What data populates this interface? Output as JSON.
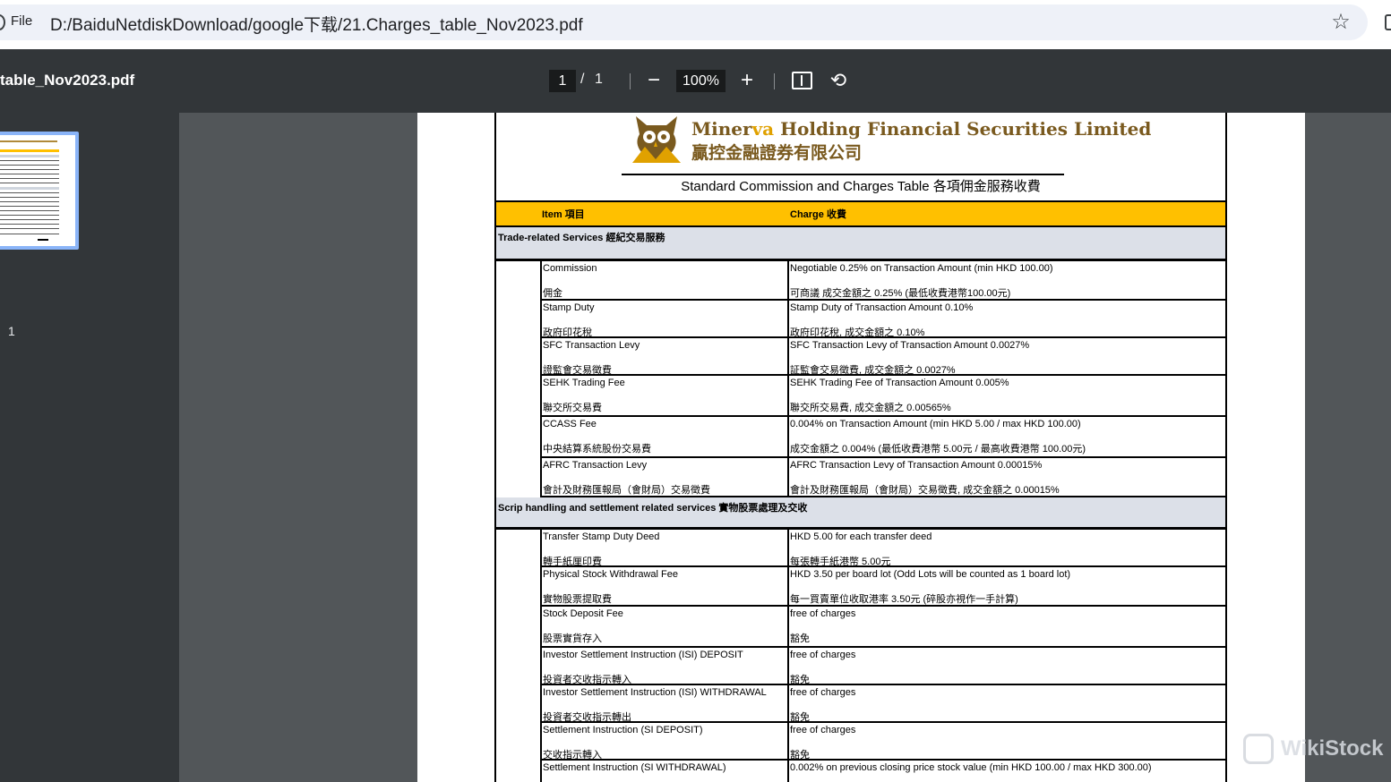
{
  "browser": {
    "chip": "File",
    "url": "D:/BaiduNetdiskDownload/google下载/21.Charges_table_Nov2023.pdf"
  },
  "toolbar": {
    "title": "table_Nov2023.pdf",
    "page_current": "1",
    "page_sep": "/",
    "page_total": "1",
    "zoom": "100%"
  },
  "sidebar": {
    "thumb_label": "1"
  },
  "document": {
    "logo_en_main": "Miner",
    "logo_en_accent": "va",
    "logo_en_rest": " Holding Financial Securities Limited",
    "logo_zh": "贏控金融證券有限公司",
    "table_title": "Standard Commission and Charges Table 各項佣金服務收費",
    "header_item": "Item 項目",
    "header_charge": "Charge 收費",
    "section1": "Trade-related Services 經紀交易服務",
    "section2": "Scrip handling and settlement related services 實物股票處理及交收",
    "rows1": [
      {
        "item_en": "Commission",
        "item_zh": "佣金",
        "charge_en": "Negotiable 0.25% on Transaction Amount (min HKD 100.00)",
        "charge_zh": "可商議 成交金額之 0.25% (最低收費港幣100.00元)"
      },
      {
        "item_en": "Stamp Duty",
        "item_zh": "政府印花稅",
        "charge_en": "Stamp Duty of Transaction Amount 0.10%",
        "charge_zh": "政府印花稅, 成交金額之 0.10%"
      },
      {
        "item_en": "SFC Transaction Levy",
        "item_zh": "證監會交易徵費",
        "charge_en": "SFC Transaction Levy of Transaction Amount 0.0027%",
        "charge_zh": "証監會交易徵費, 成交金額之 0.0027%"
      },
      {
        "item_en": "SEHK Trading Fee",
        "item_zh": "聯交所交易費",
        "charge_en": "SEHK Trading Fee of Transaction Amount 0.005%",
        "charge_zh": "聯交所交易費, 成交金額之 0.00565%"
      },
      {
        "item_en": "CCASS Fee",
        "item_zh": "中央結算系統股份交易費",
        "charge_en": "0.004% on Transaction Amount (min HKD 5.00 / max HKD 100.00)",
        "charge_zh": "成交金額之 0.004% (最低收費港幣 5.00元 / 最高收費港幣 100.00元)"
      },
      {
        "item_en": "AFRC Transaction Levy",
        "item_zh": "會計及財務匯報局（會財局）交易徵費",
        "charge_en": "AFRC Transaction Levy of Transaction Amount 0.00015%",
        "charge_zh": "會計及財務匯報局（會財局）交易徵費, 成交金額之  0.00015%"
      }
    ],
    "rows2": [
      {
        "item_en": "Transfer Stamp Duty Deed",
        "item_zh": "轉手紙厘印費",
        "charge_en": "HKD 5.00 for each transfer deed",
        "charge_zh": "每張轉手紙港幣 5.00元"
      },
      {
        "item_en": "Physical Stock Withdrawal Fee",
        "item_zh": "實物股票提取費",
        "charge_en": "HKD 3.50 per board lot (Odd Lots will be counted as 1 board lot)",
        "charge_zh": "每一買賣單位收取港率 3.50元 (碎股亦視作一手計算)"
      },
      {
        "item_en": "Stock Deposit Fee",
        "item_zh": "股票實貨存入",
        "charge_en": "free of charges",
        "charge_zh": "豁免"
      },
      {
        "item_en": "Investor Settlement Instruction (ISI) DEPOSIT",
        "item_zh": "投資者交收指示轉入",
        "charge_en": "free of charges",
        "charge_zh": "豁免"
      },
      {
        "item_en": "Investor Settlement Instruction (ISI) WITHDRAWAL",
        "item_zh": "投資者交收指示轉出",
        "charge_en": "free of charges",
        "charge_zh": "豁免"
      },
      {
        "item_en": "Settlement Instruction (SI DEPOSIT)",
        "item_zh": "交收指示轉入",
        "charge_en": "free of charges",
        "charge_zh": "豁免"
      },
      {
        "item_en": "Settlement Instruction (SI WITHDRAWAL)",
        "item_zh": "",
        "charge_en": "0.002% on previous closing price stock value (min HKD 100.00 / max HKD 300.00)",
        "charge_zh": ""
      }
    ]
  },
  "watermark": "WikiStock",
  "colors": {
    "header_bg": "#ffc000",
    "section_bg": "#dce0e8",
    "toolbar_bg": "#323639",
    "viewer_bg": "#525659"
  }
}
